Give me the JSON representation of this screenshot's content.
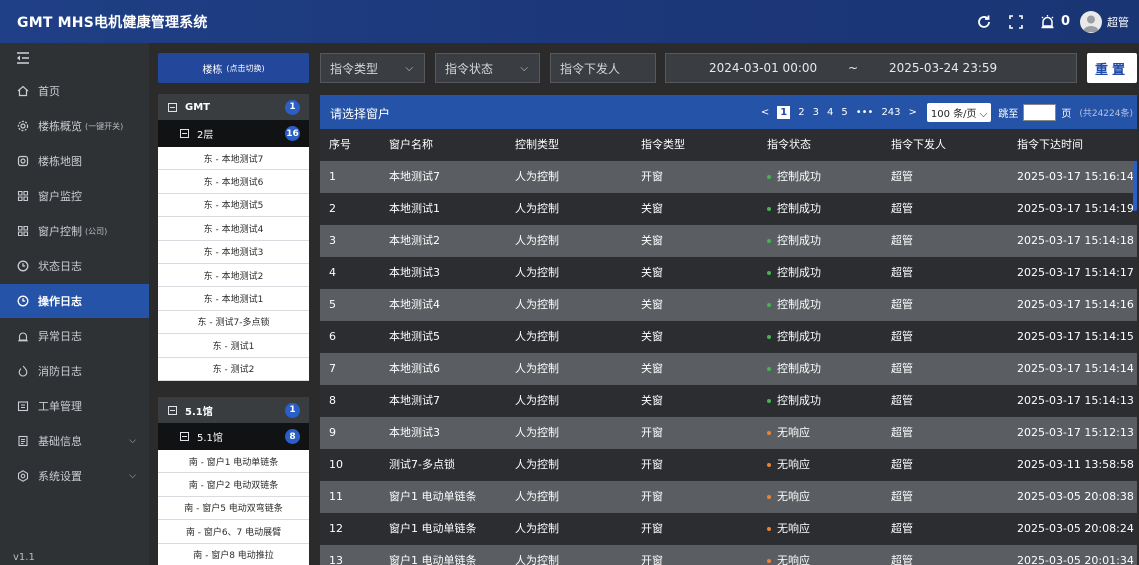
{
  "header": {
    "title": "GMT MHS电机健康管理系统",
    "bell_count": "0",
    "user_name": "超管",
    "icons": [
      "refresh-icon",
      "fullscreen-icon",
      "alarm-bell-icon",
      "user-avatar-icon"
    ]
  },
  "sidebar": {
    "items": [
      {
        "label": "首页",
        "sub": "",
        "icon": "home-icon"
      },
      {
        "label": "楼栋概览",
        "sub": "(一键开关)",
        "icon": "gear-icon"
      },
      {
        "label": "楼栋地图",
        "sub": "",
        "icon": "map-icon"
      },
      {
        "label": "窗户监控",
        "sub": "",
        "icon": "grid-icon"
      },
      {
        "label": "窗户控制",
        "sub": "(公司)",
        "icon": "grid-icon"
      },
      {
        "label": "状态日志",
        "sub": "",
        "icon": "clock-icon"
      },
      {
        "label": "操作日志",
        "sub": "",
        "icon": "clock-icon"
      },
      {
        "label": "异常日志",
        "sub": "",
        "icon": "alarm-icon"
      },
      {
        "label": "消防日志",
        "sub": "",
        "icon": "fire-icon"
      },
      {
        "label": "工单管理",
        "sub": "",
        "icon": "workorder-icon"
      },
      {
        "label": "基础信息",
        "sub": "",
        "icon": "info-icon",
        "chevron": true
      },
      {
        "label": "系统设置",
        "sub": "",
        "icon": "settings-icon",
        "chevron": true
      }
    ],
    "active_index": 6,
    "version": "v1.1"
  },
  "buildings": {
    "button_label": "楼栋",
    "button_sub": "(点击切换)",
    "groups": [
      {
        "name": "GMT",
        "count": "1",
        "floor": "2层",
        "floor_count": "16",
        "windows": [
          "东 - 本地测试7",
          "东 - 本地测试6",
          "东 - 本地测试5",
          "东 - 本地测试4",
          "东 - 本地测试3",
          "东 - 本地测试2",
          "东 - 本地测试1",
          "东 - 测试7-多点锁",
          "东 - 测试1",
          "东 - 测试2"
        ]
      },
      {
        "name": "5.1馆",
        "count": "1",
        "floor": "5.1馆",
        "floor_count": "8",
        "windows": [
          "南 - 窗户1 电动单链条",
          "南 - 窗户2 电动双链条",
          "南 - 窗户5 电动双弯链条",
          "南 - 窗户6、7 电动展臂",
          "南 - 窗户8 电动推拉"
        ]
      }
    ]
  },
  "filters": {
    "command_type": "指令类型",
    "command_status": "指令状态",
    "issuer": "指令下发人",
    "date_start": "2024-03-01 00:00",
    "date_sep": "~",
    "date_end": "2025-03-24 23:59",
    "reset": "重置"
  },
  "table": {
    "title": "请选择窗户",
    "pager": {
      "prev": "<",
      "pages": [
        "1",
        "2",
        "3",
        "4",
        "5",
        "•••",
        "243"
      ],
      "next": ">",
      "page_size": "100 条/页",
      "jump_label": "跳至",
      "page_unit": "页",
      "total": "(共24224条)"
    },
    "columns": [
      "序号",
      "窗户名称",
      "控制类型",
      "指令类型",
      "指令状态",
      "指令下发人",
      "指令下达时间"
    ],
    "status_colors": {
      "控制成功": "#4caf50",
      "无响应": "#e8823a"
    },
    "rows": [
      [
        "1",
        "本地测试7",
        "人为控制",
        "开窗",
        "控制成功",
        "超管",
        "2025-03-17 15:16:14"
      ],
      [
        "2",
        "本地测试1",
        "人为控制",
        "关窗",
        "控制成功",
        "超管",
        "2025-03-17 15:14:19"
      ],
      [
        "3",
        "本地测试2",
        "人为控制",
        "关窗",
        "控制成功",
        "超管",
        "2025-03-17 15:14:18"
      ],
      [
        "4",
        "本地测试3",
        "人为控制",
        "关窗",
        "控制成功",
        "超管",
        "2025-03-17 15:14:17"
      ],
      [
        "5",
        "本地测试4",
        "人为控制",
        "关窗",
        "控制成功",
        "超管",
        "2025-03-17 15:14:16"
      ],
      [
        "6",
        "本地测试5",
        "人为控制",
        "关窗",
        "控制成功",
        "超管",
        "2025-03-17 15:14:15"
      ],
      [
        "7",
        "本地测试6",
        "人为控制",
        "关窗",
        "控制成功",
        "超管",
        "2025-03-17 15:14:14"
      ],
      [
        "8",
        "本地测试7",
        "人为控制",
        "关窗",
        "控制成功",
        "超管",
        "2025-03-17 15:14:13"
      ],
      [
        "9",
        "本地测试3",
        "人为控制",
        "开窗",
        "无响应",
        "超管",
        "2025-03-17 15:12:13"
      ],
      [
        "10",
        "测试7-多点锁",
        "人为控制",
        "开窗",
        "无响应",
        "超管",
        "2025-03-11 13:58:58"
      ],
      [
        "11",
        "窗户1 电动单链条",
        "人为控制",
        "开窗",
        "无响应",
        "超管",
        "2025-03-05 20:08:38"
      ],
      [
        "12",
        "窗户1 电动单链条",
        "人为控制",
        "开窗",
        "无响应",
        "超管",
        "2025-03-05 20:08:24"
      ],
      [
        "13",
        "窗户1 电动单链条",
        "人为控制",
        "开窗",
        "无响应",
        "超管",
        "2025-03-05 20:01:34"
      ]
    ]
  }
}
